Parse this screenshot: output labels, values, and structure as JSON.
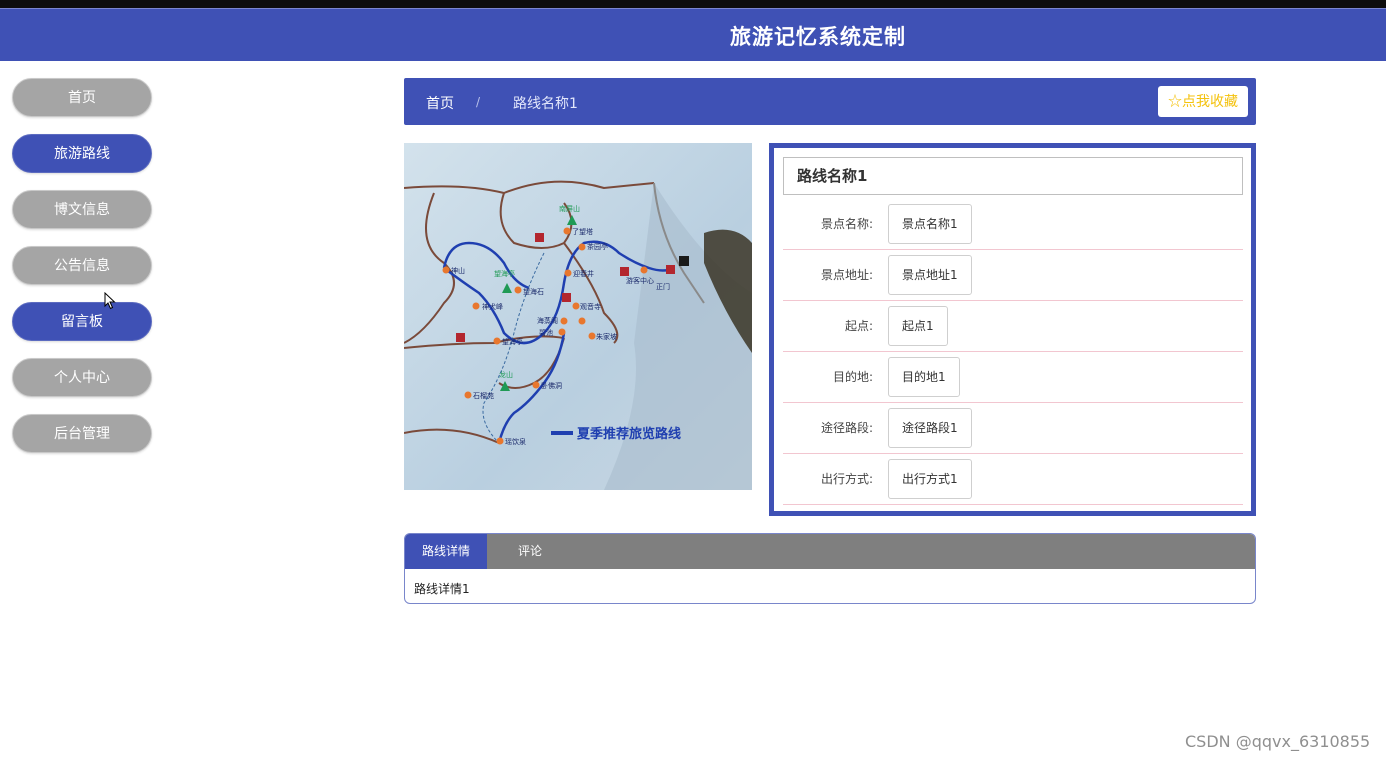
{
  "header": {
    "title": "旅游记忆系统定制"
  },
  "sidebar": {
    "items": [
      {
        "label": "首页",
        "active": false
      },
      {
        "label": "旅游路线",
        "active": true
      },
      {
        "label": "博文信息",
        "active": false
      },
      {
        "label": "公告信息",
        "active": false
      },
      {
        "label": "留言板",
        "active": true
      },
      {
        "label": "个人中心",
        "active": false
      },
      {
        "label": "后台管理",
        "active": false
      }
    ]
  },
  "breadcrumb": {
    "home": "首页",
    "separator": "/",
    "current": "路线名称1"
  },
  "favorite": {
    "icon": "star-outline-icon",
    "label": "点我收藏",
    "color": "#f4c20d"
  },
  "map_image": {
    "caption": "夏季推荐旅览路线",
    "peaks": [
      "南屏山",
      "望海亭",
      "龙山"
    ],
    "places": [
      "了望塔",
      "茶园亭",
      "神山",
      "望海石",
      "迎春井",
      "游客中心",
      "正门",
      "神犬峰",
      "观音寺",
      "海蒸阁",
      "碧池",
      "朱家坡",
      "望海亭",
      "卧佛洞",
      "石榴苑",
      "瑶饮泉"
    ]
  },
  "detail": {
    "name": "路线名称1",
    "fields": [
      {
        "label": "景点名称:",
        "value": "景点名称1"
      },
      {
        "label": "景点地址:",
        "value": "景点地址1"
      },
      {
        "label": "起点:",
        "value": "起点1"
      },
      {
        "label": "目的地:",
        "value": "目的地1"
      },
      {
        "label": "途径路段:",
        "value": "途径路段1"
      },
      {
        "label": "出行方式:",
        "value": "出行方式1"
      }
    ]
  },
  "tabs": {
    "items": [
      {
        "label": "路线详情",
        "active": true
      },
      {
        "label": "评论",
        "active": false
      }
    ],
    "content": "路线详情1"
  },
  "watermark": "CSDN @qqvx_6310855",
  "colors": {
    "primary": "#3f51b5",
    "inactive_nav": "#a5a5a5",
    "tab_bar": "#7f7f7f"
  }
}
